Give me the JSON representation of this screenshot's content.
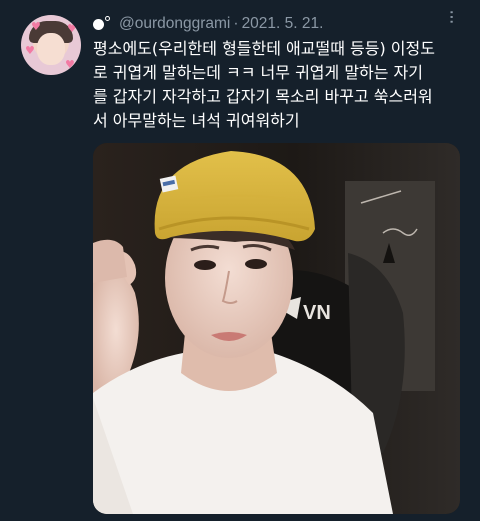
{
  "tweet": {
    "handle": "@ourdonggrami",
    "separator": "·",
    "date": "2021. 5. 21.",
    "text_lines": [
      "평소에도(우리한테 형들한테 애교떨때 등등) 이정도",
      "로 귀엽게 말하는데 ㅋㅋ 너무 귀엽게 말하는 자기",
      "를 갑자기 자각하고 갑자기 목소리 바꾸고 쑥스러워",
      "서 아무말하는 녀석 귀여워하기"
    ],
    "media": {
      "chair_brand_text": "VN"
    }
  },
  "colors": {
    "background": "#15202b",
    "secondary_text": "#8b98a5",
    "beanie": "#d9b43a",
    "shirt": "#f4f1ee"
  },
  "icons": {
    "avatar": "profile-avatar",
    "name_icon": "circle-dots-name-icon",
    "more": "more-options-icon"
  }
}
